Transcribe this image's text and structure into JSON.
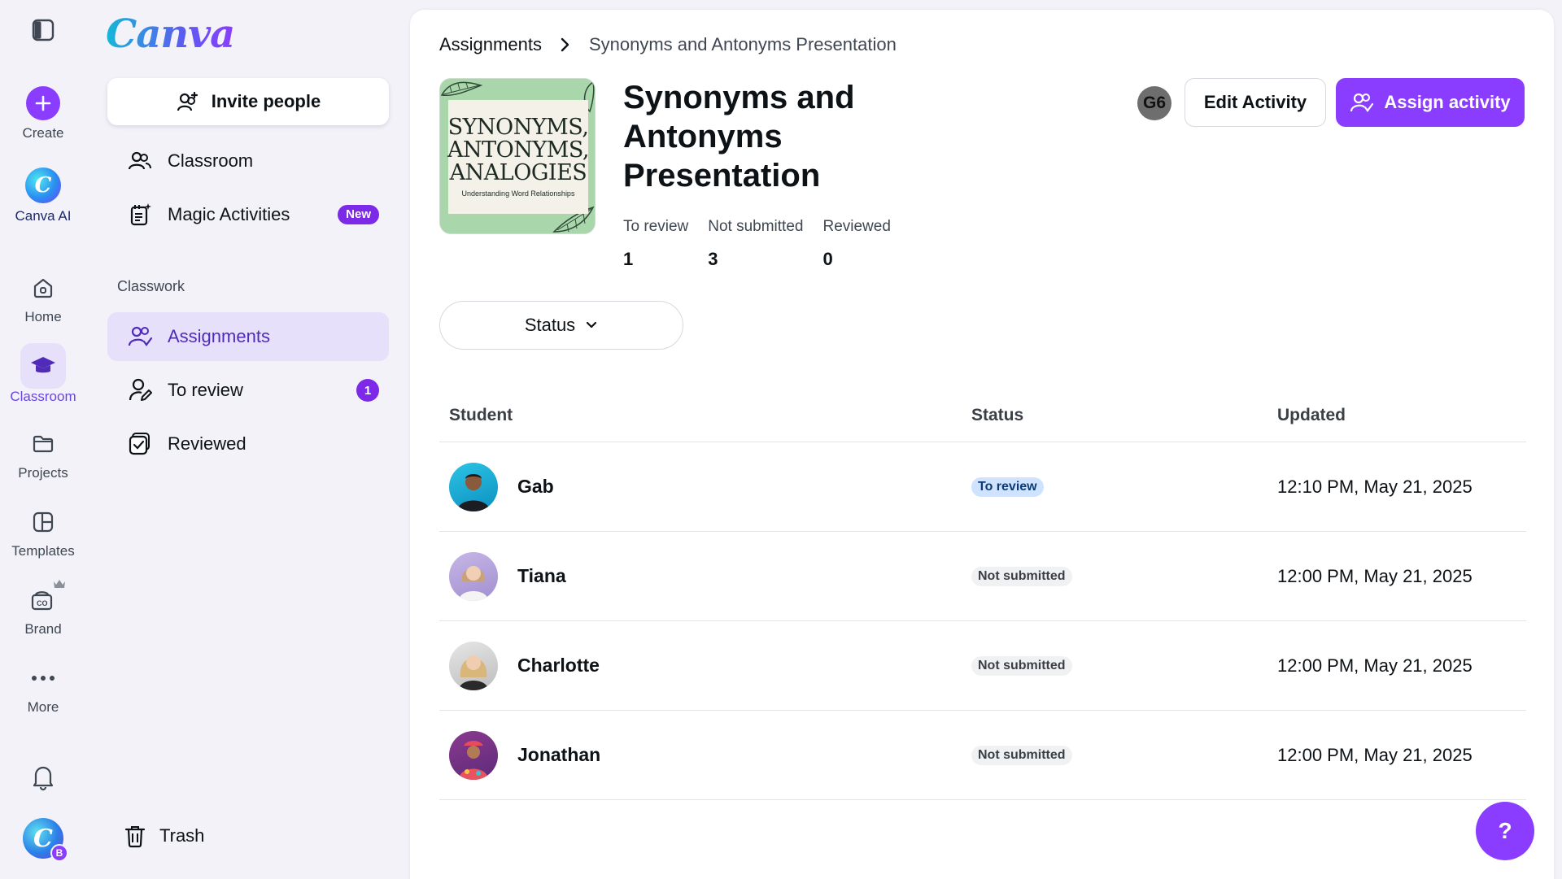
{
  "rail": {
    "items": [
      {
        "label": "Create"
      },
      {
        "label": "Canva AI"
      },
      {
        "label": "Home"
      },
      {
        "label": "Classroom"
      },
      {
        "label": "Projects"
      },
      {
        "label": "Templates"
      },
      {
        "label": "Brand"
      },
      {
        "label": "More"
      }
    ],
    "user_badge": "B",
    "accent": "#8b3dff"
  },
  "sidebar": {
    "logo": "Canva",
    "invite_label": "Invite people",
    "items": [
      {
        "label": "Classroom",
        "icon": "people-icon"
      },
      {
        "label": "Magic Activities",
        "icon": "magic-activities-icon",
        "badge": "New"
      }
    ],
    "section_label": "Classwork",
    "classwork": [
      {
        "label": "Assignments",
        "icon": "assignments-icon",
        "active": true
      },
      {
        "label": "To review",
        "icon": "person-edit-icon",
        "badge": "1"
      },
      {
        "label": "Reviewed",
        "icon": "checkbox-icon"
      }
    ],
    "trash_label": "Trash"
  },
  "breadcrumb": {
    "parent": "Assignments",
    "separator": "›",
    "current": "Synonyms and Antonyms Presentation"
  },
  "activity": {
    "title": "Synonyms and Antonyms Presentation",
    "thumbnail": {
      "line1": "SYNONYMS,",
      "line2": "ANTONYMS,",
      "line3": "ANALOGIES",
      "subtitle": "Understanding Word Relationships"
    },
    "stats": [
      {
        "label": "To review",
        "value": "1"
      },
      {
        "label": "Not submitted",
        "value": "3"
      },
      {
        "label": "Reviewed",
        "value": "0"
      }
    ],
    "owner_avatar": "G6",
    "edit_label": "Edit Activity",
    "assign_label": "Assign activity"
  },
  "filter": {
    "label": "Status"
  },
  "table": {
    "headers": {
      "student": "Student",
      "status": "Status",
      "updated": "Updated"
    },
    "rows": [
      {
        "name": "Gab",
        "status": "To review",
        "status_type": "review",
        "updated": "12:10 PM, May 21, 2025"
      },
      {
        "name": "Tiana",
        "status": "Not submitted",
        "status_type": "not",
        "updated": "12:00 PM, May 21, 2025"
      },
      {
        "name": "Charlotte",
        "status": "Not submitted",
        "status_type": "not",
        "updated": "12:00 PM, May 21, 2025"
      },
      {
        "name": "Jonathan",
        "status": "Not submitted",
        "status_type": "not",
        "updated": "12:00 PM, May 21, 2025"
      }
    ]
  },
  "help": {
    "label": "?"
  }
}
